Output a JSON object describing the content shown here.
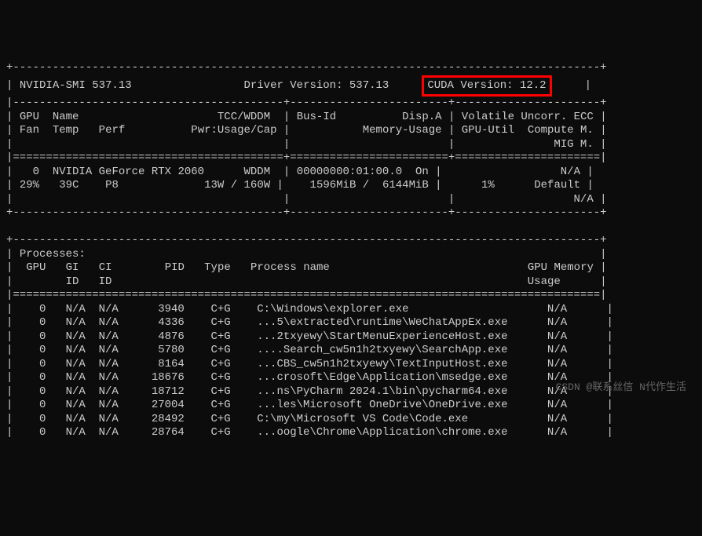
{
  "header": {
    "nvidia_smi": "NVIDIA-SMI 537.13",
    "driver_version": "Driver Version: 537.13",
    "cuda_version": "CUDA Version: 12.2"
  },
  "table_headers": {
    "gpu": "GPU",
    "name": "Name",
    "tcc_wddm": "TCC/WDDM",
    "bus_id": "Bus-Id",
    "disp_a": "Disp.A",
    "volatile": "Volatile",
    "uncorr_ecc": "Uncorr. ECC",
    "fan": "Fan",
    "temp": "Temp",
    "perf": "Perf",
    "pwr": "Pwr:Usage/Cap",
    "memory_usage": "Memory-Usage",
    "gpu_util": "GPU-Util",
    "compute_m": "Compute M.",
    "mig_m": "MIG M."
  },
  "gpu_data": {
    "gpu_id": "0",
    "name": "NVIDIA GeForce RTX 2060",
    "mode": "WDDM",
    "bus_id": "00000000:01:00.0",
    "disp_a": "On",
    "ecc": "N/A",
    "fan": "29%",
    "temp": "39C",
    "perf": "P8",
    "pwr": "13W / 160W",
    "memory": "1596MiB /  6144MiB",
    "gpu_util": "1%",
    "compute_m": "Default",
    "mig_m": "N/A"
  },
  "processes": {
    "title": "Processes:",
    "headers": {
      "gpu": "GPU",
      "gi_id": "GI",
      "ci_id": "CI",
      "id": "ID",
      "pid": "PID",
      "type": "Type",
      "process_name": "Process name",
      "gpu_memory": "GPU Memory",
      "usage": "Usage"
    },
    "rows": [
      {
        "gpu": "0",
        "gi": "N/A",
        "ci": "N/A",
        "pid": "3940",
        "type": "C+G",
        "name": "C:\\Windows\\explorer.exe",
        "mem": "N/A"
      },
      {
        "gpu": "0",
        "gi": "N/A",
        "ci": "N/A",
        "pid": "4336",
        "type": "C+G",
        "name": "...5\\extracted\\runtime\\WeChatAppEx.exe",
        "mem": "N/A"
      },
      {
        "gpu": "0",
        "gi": "N/A",
        "ci": "N/A",
        "pid": "4876",
        "type": "C+G",
        "name": "...2txyewy\\StartMenuExperienceHost.exe",
        "mem": "N/A"
      },
      {
        "gpu": "0",
        "gi": "N/A",
        "ci": "N/A",
        "pid": "5780",
        "type": "C+G",
        "name": "....Search_cw5n1h2txyewy\\SearchApp.exe",
        "mem": "N/A"
      },
      {
        "gpu": "0",
        "gi": "N/A",
        "ci": "N/A",
        "pid": "8164",
        "type": "C+G",
        "name": "...CBS_cw5n1h2txyewy\\TextInputHost.exe",
        "mem": "N/A"
      },
      {
        "gpu": "0",
        "gi": "N/A",
        "ci": "N/A",
        "pid": "18676",
        "type": "C+G",
        "name": "...crosoft\\Edge\\Application\\msedge.exe",
        "mem": "N/A"
      },
      {
        "gpu": "0",
        "gi": "N/A",
        "ci": "N/A",
        "pid": "18712",
        "type": "C+G",
        "name": "...ns\\PyCharm 2024.1\\bin\\pycharm64.exe",
        "mem": "N/A"
      },
      {
        "gpu": "0",
        "gi": "N/A",
        "ci": "N/A",
        "pid": "27004",
        "type": "C+G",
        "name": "...les\\Microsoft OneDrive\\OneDrive.exe",
        "mem": "N/A"
      },
      {
        "gpu": "0",
        "gi": "N/A",
        "ci": "N/A",
        "pid": "28492",
        "type": "C+G",
        "name": "C:\\my\\Microsoft VS Code\\Code.exe",
        "mem": "N/A"
      },
      {
        "gpu": "0",
        "gi": "N/A",
        "ci": "N/A",
        "pid": "28764",
        "type": "C+G",
        "name": "...oogle\\Chrome\\Application\\chrome.exe",
        "mem": "N/A"
      }
    ]
  },
  "watermark": "CSDN @联系丝信 N代作生活"
}
